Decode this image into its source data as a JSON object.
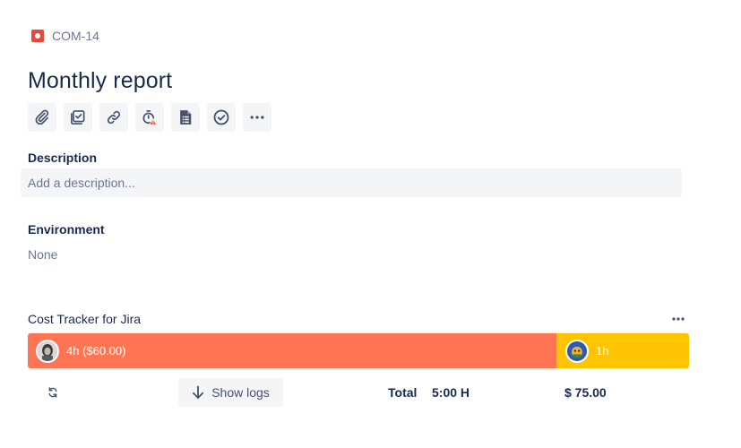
{
  "breadcrumb": {
    "issue_type_icon": "bug-icon",
    "issue_key": "COM-14"
  },
  "issue": {
    "title": "Monthly report"
  },
  "toolbar": {
    "buttons": [
      {
        "icon": "attachment-icon"
      },
      {
        "icon": "subtask-icon"
      },
      {
        "icon": "link-icon"
      },
      {
        "icon": "stopwatch-warning-icon"
      },
      {
        "icon": "sheet-document-icon"
      },
      {
        "icon": "check-circle-icon"
      },
      {
        "icon": "more-icon"
      }
    ]
  },
  "description": {
    "label": "Description",
    "placeholder": "Add a description..."
  },
  "environment": {
    "label": "Environment",
    "value": "None"
  },
  "cost_tracker": {
    "title": "Cost Tracker for Jira",
    "segments": [
      {
        "label": "4h ($60.00)",
        "color": "#ff7452",
        "hours": 4
      },
      {
        "label": "1h",
        "color": "#ffc400",
        "hours": 1
      }
    ],
    "show_logs_label": "Show logs",
    "total_label": "Total",
    "total_time": "5:00 H",
    "total_cost": "$ 75.00"
  },
  "colors": {
    "text_primary": "#172b4d",
    "text_subtle": "#6b778c",
    "surface": "#f4f5f7",
    "bug_red": "#e5493a"
  }
}
